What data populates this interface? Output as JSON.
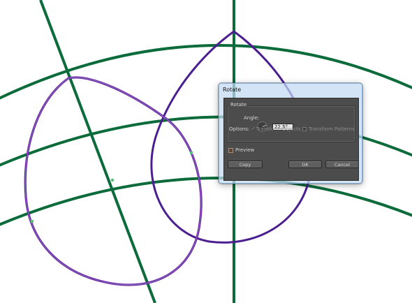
{
  "window": {
    "title": "Rotate"
  },
  "rotate_group": {
    "label": "Rotate",
    "angle_label": "Angle:",
    "angle_value": "22,5°",
    "options_label": "Options:",
    "transform_objects": {
      "label": "Transform Objects",
      "checked": true,
      "enabled": false
    },
    "transform_patterns": {
      "label": "Transform Patterns",
      "checked": false,
      "enabled": false
    }
  },
  "preview": {
    "label": "Preview",
    "checked": false
  },
  "buttons": {
    "copy": "Copy",
    "ok": "OK",
    "cancel": "Cancel"
  },
  "colors": {
    "guide_green": "#0b6b3a",
    "shape_purple": "#6a1fa0",
    "rotated_purple": "#4b1f8f",
    "dialog_gray": "#4c4c4c"
  }
}
